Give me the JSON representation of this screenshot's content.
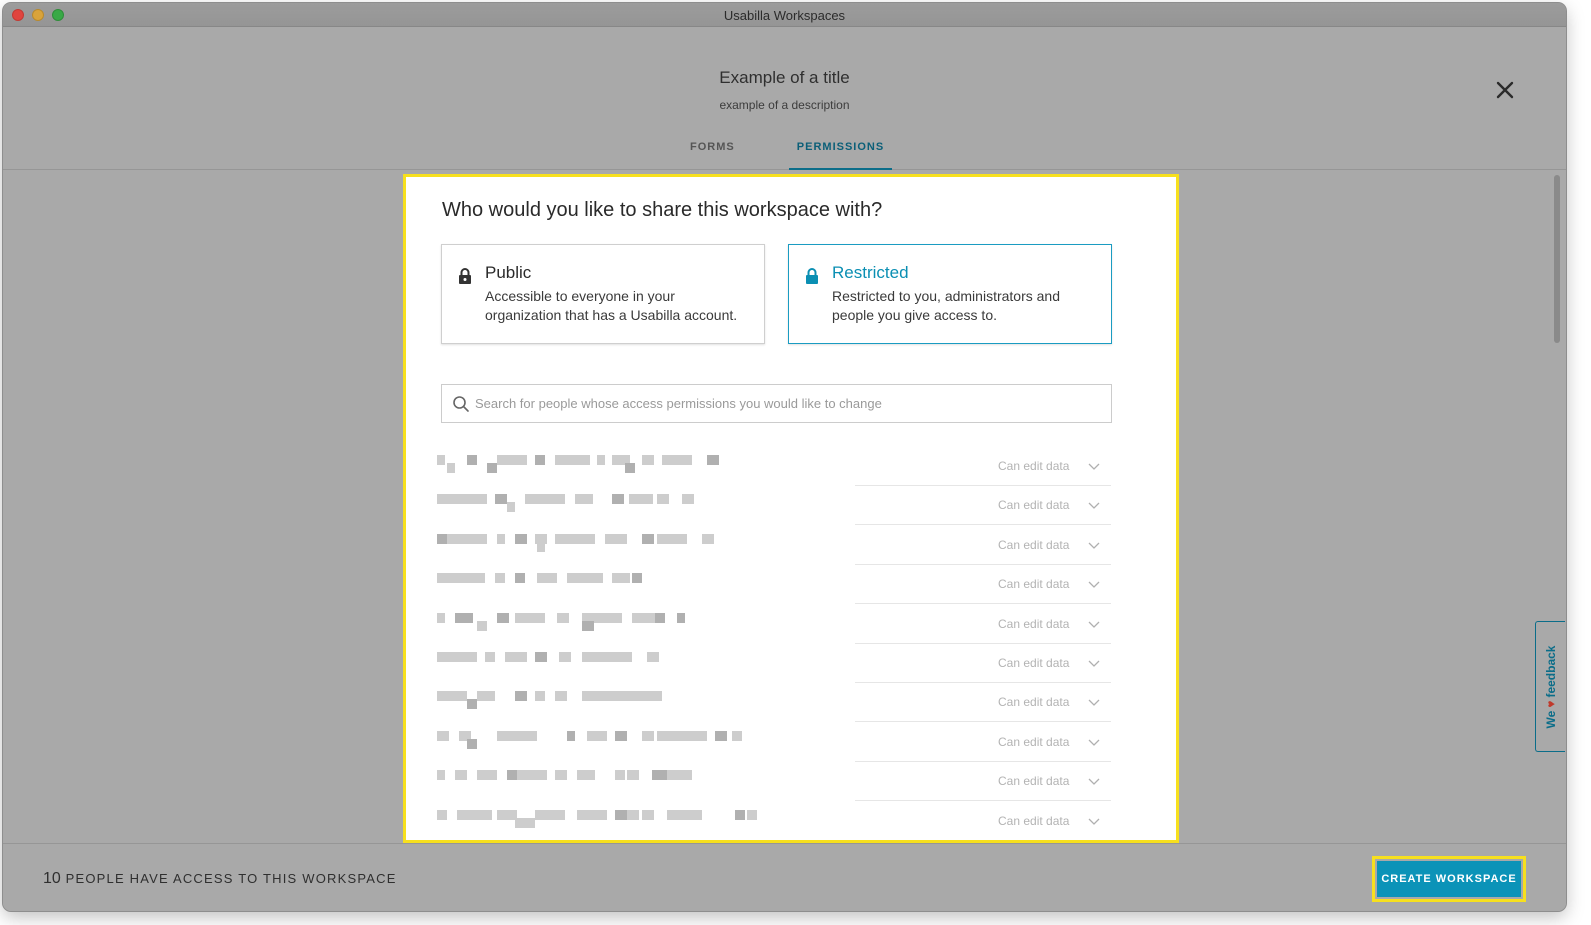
{
  "window": {
    "title": "Usabilla Workspaces"
  },
  "header": {
    "title": "Example of a title",
    "description": "example of a description",
    "tabs": [
      {
        "label": "FORMS",
        "active": false
      },
      {
        "label": "PERMISSIONS",
        "active": true
      }
    ]
  },
  "share": {
    "heading": "Who would you like to share this workspace with?",
    "options": [
      {
        "title": "Public",
        "description": "Accessible to everyone in your organization that has a Usabilla account.",
        "selected": false
      },
      {
        "title": "Restricted",
        "description": "Restricted to you, administrators and people you give access to.",
        "selected": true
      }
    ],
    "search": {
      "placeholder": "Search for people whose access permissions you would like to change",
      "value": ""
    }
  },
  "people": [
    {
      "permission": "Can edit data"
    },
    {
      "permission": "Can edit data"
    },
    {
      "permission": "Can edit data"
    },
    {
      "permission": "Can edit data"
    },
    {
      "permission": "Can edit data"
    },
    {
      "permission": "Can edit data"
    },
    {
      "permission": "Can edit data"
    },
    {
      "permission": "Can edit data"
    },
    {
      "permission": "Can edit data"
    },
    {
      "permission": "Can edit data"
    }
  ],
  "footer": {
    "count": "10",
    "access_text": "PEOPLE HAVE ACCESS TO THIS WORKSPACE",
    "create_label": "CREATE WORKSPACE"
  },
  "feedback": {
    "before": "We",
    "after": "feedback"
  },
  "colors": {
    "accent": "#0b93b8",
    "highlight": "#f7e01e",
    "overlay": "#a9a9a9"
  }
}
